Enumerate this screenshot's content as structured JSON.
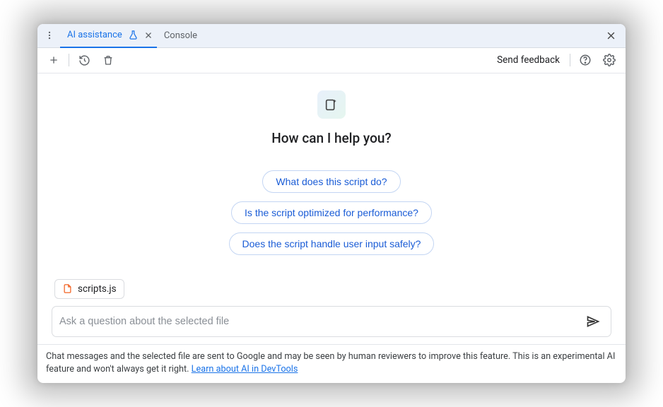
{
  "tabs": {
    "ai_assistance": "AI assistance",
    "console": "Console"
  },
  "toolbar": {
    "send_feedback": "Send feedback"
  },
  "main": {
    "heading": "How can I help you?",
    "suggestions": [
      "What does this script do?",
      "Is the script optimized for performance?",
      "Does the script handle user input safely?"
    ],
    "selected_file": "scripts.js",
    "input_placeholder": "Ask a question about the selected file"
  },
  "footer": {
    "text": "Chat messages and the selected file are sent to Google and may be seen by human reviewers to improve this feature. This is an experimental AI feature and won't always get it right. ",
    "link_text": "Learn about AI in DevTools"
  }
}
